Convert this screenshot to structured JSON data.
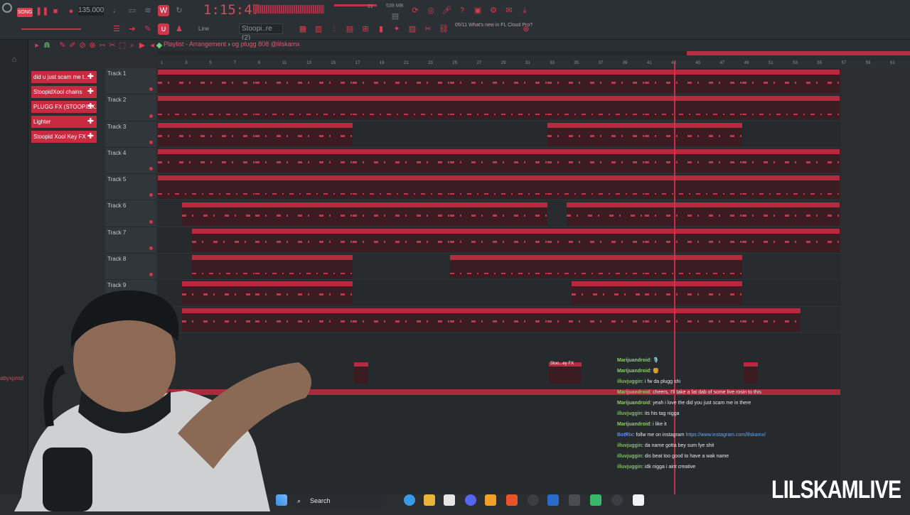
{
  "toolbar": {
    "song_label": "SONG",
    "tempo": "135.000",
    "time": "1:15:47",
    "memory": "539 MB",
    "cpu": "21",
    "cpu2": "6",
    "pattern": "Stoopi..re (2)",
    "snap": "Line",
    "news_date": "05/11",
    "news_text": "What's new in FL Cloud Pro?"
  },
  "playlist": {
    "title_prefix": "Playlist - Arrangement",
    "title_sep": "›",
    "title_pattern": "og plugg 808 @lilskamx"
  },
  "patterns": [
    {
      "label": "did u just scam me t..."
    },
    {
      "label": "StoopidXool chains"
    },
    {
      "label": "PLUGG FX (STOOPIDX..."
    },
    {
      "label": "Lighter"
    },
    {
      "label": "Stoopid Xool Key FX"
    }
  ],
  "ruler": [
    "1",
    "3",
    "5",
    "7",
    "9",
    "11",
    "13",
    "15",
    "17",
    "19",
    "21",
    "23",
    "25",
    "27",
    "29",
    "31",
    "33",
    "35",
    "37",
    "39",
    "41",
    "43",
    "45",
    "47",
    "49",
    "51",
    "53",
    "55",
    "57",
    "59",
    "61"
  ],
  "tracks": [
    {
      "name": "Track 1",
      "clips": [
        {
          "label": "XV-5080"
        },
        {
          "label": "XV-5080"
        },
        {
          "label": "XV-5080"
        },
        {
          "label": "XV-5080"
        },
        {
          "label": "XV-5080"
        },
        {
          "label": "XV-5080"
        },
        {
          "label": "XV-5080"
        }
      ]
    },
    {
      "name": "Track 2",
      "clips": [
        {
          "label": "65 PCM Archives"
        },
        {
          "label": "65 PCM Archives"
        },
        {
          "label": "65 PCM Archives"
        },
        {
          "label": "65 PCM Archives"
        },
        {
          "label": "65 PCM Archives"
        },
        {
          "label": "65 PCM Archives"
        },
        {
          "label": "65 PCM Archives"
        }
      ]
    },
    {
      "name": "Track 3",
      "clips": [
        {
          "label": "65 Little P.C.M 2"
        },
        {
          "label": "65 Little P.C.M 2"
        },
        {
          "label": "65 Little P.C.M 2"
        },
        {
          "label": "65 Little P.C.M 2"
        }
      ]
    },
    {
      "name": "Track 4",
      "clips": [
        {
          "label": "65 Little P.C.M 2 #2"
        },
        {
          "label": "65 Little P.C.M 2 #2"
        },
        {
          "label": "65 Little P.C.M 2 #2"
        },
        {
          "label": "65 Little P.C.M 2 #2"
        },
        {
          "label": "65 Little P.C.M 2 #2"
        },
        {
          "label": "65 Little P.C.M 2 #2"
        },
        {
          "label": "65 Little P.C.M 2 #2"
        }
      ]
    },
    {
      "name": "Track 5",
      "clips": [
        {
          "label": "MexikoDro HH (2)"
        },
        {
          "label": "MexikoDro HH (2)"
        },
        {
          "label": "MexikoDro HH (2)"
        },
        {
          "label": "MexikoDro HH (2)"
        },
        {
          "label": "MexikoDro HH (2)"
        },
        {
          "label": "MexikoDro HH (2)"
        },
        {
          "label": "MexikoDro HH (2)"
        }
      ]
    },
    {
      "name": "Track 6",
      "clips": [
        {
          "label": "MexikoDro clap (2)"
        },
        {
          "label": "MexikoDro clap (2)"
        },
        {
          "label": "MexikoDro clap (2)"
        },
        {
          "label": "MexikoDro clap (2)"
        },
        {
          "label": "MexikoDro clap (2)"
        },
        {
          "label": "MexikoDro clap (2)"
        },
        {
          "label": "MexikoDro clap (2)"
        }
      ]
    },
    {
      "name": "Track 7",
      "clips": [
        {
          "label": "StoopidXo..snare (2)"
        },
        {
          "label": "StoopidXool snare (2)"
        },
        {
          "label": "StoopidXool snare (2)"
        },
        {
          "label": "StoopidXool snare (2)"
        },
        {
          "label": "StoopidXool snare (2)"
        },
        {
          "label": "StoopidXool snare (2)"
        },
        {
          "label": "StoopidXool snare (2)"
        }
      ]
    },
    {
      "name": "Track 8",
      "clips": [
        {
          "label": "MexikoDro snare (1)"
        },
        {
          "label": "MexikoDro snare (1)"
        },
        {
          "label": "MexikoDro snare (1)"
        },
        {
          "label": "MexikoDro snare (1)"
        },
        {
          "label": "MexikoDro snare (1)"
        }
      ]
    },
    {
      "name": "Track 9",
      "clips": [
        {
          "label": "chant - common"
        },
        {
          "label": "chant - common"
        },
        {
          "label": "chant - common"
        },
        {
          "label": "chant - common"
        }
      ]
    },
    {
      "name": "",
      "clips": [
        {
          "label": "og pl..skamx"
        },
        {
          "label": "og plugg 808 @lilskamx"
        },
        {
          "label": "og plugg 808 @lilskamx"
        },
        {
          "label": "og plugg 808 @lilskamx"
        },
        {
          "label": "og plugg 808 @lilskamx"
        },
        {
          "label": "og plugg 808 @lilskamx"
        },
        {
          "label": "og plugg 808 @lilskamx"
        }
      ]
    }
  ],
  "fx_clip": "Stoo...ey FX",
  "chat": [
    {
      "user": "Marijuandroid",
      "text": ": 🎙️",
      "cls": "u1"
    },
    {
      "user": "Marijuandroid",
      "text": ": 🍔",
      "cls": "u1"
    },
    {
      "user": "illuvjuggin",
      "text": ": i fw da plugg shi",
      "cls": "u3"
    },
    {
      "user": "Marijuandroid",
      "text": ": cheers, I'll take a fat dab of some live rosin to this",
      "cls": "u1"
    },
    {
      "user": "Marijuandroid",
      "text": ": yeah i love the did you just scam me in there",
      "cls": "u1"
    },
    {
      "user": "illuvjuggin",
      "text": ": its his tag nigga",
      "cls": "u3"
    },
    {
      "user": "Marijuandroid",
      "text": ": i like it",
      "cls": "u1"
    },
    {
      "user": "BotRix",
      "text": ": follw me on instagram ",
      "link": "https://www.instagram.com/lilskamx/",
      "cls": "u2"
    },
    {
      "user": "illuvjuggin",
      "text": ": da name gotta bey sum fye shit",
      "cls": "u3"
    },
    {
      "user": "illuvjuggin",
      "text": ": dis beat too good to have a wak name",
      "cls": "u3"
    },
    {
      "user": "illuvjuggin",
      "text": ": idk nigga i aint creative",
      "cls": "u3"
    }
  ],
  "taskbar": {
    "search": "Search"
  },
  "side_name": "abyxprod",
  "watermark": "LILSKAMLIVE",
  "colors": {
    "accent": "#d0374c",
    "background": "#262a2d",
    "clip_header": "#b8283e"
  }
}
